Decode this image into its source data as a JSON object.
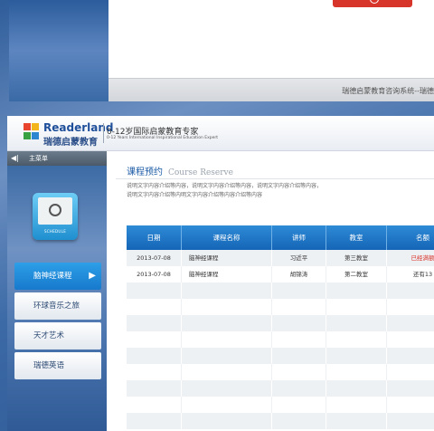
{
  "previous_window": {
    "footer_text": "瑞德启蒙教育咨询系统--瑞德",
    "partial_text": "……………………"
  },
  "header": {
    "brand_en": "Readerland",
    "brand_cn": "瑞德启蒙教育",
    "slogan": "0-12岁国际启蒙教育专家",
    "slogan_en": "0-12 Years International Inspirational Education Expert"
  },
  "sidebar": {
    "menu_title": "主菜单",
    "device_label": "SCHEDULE",
    "items": [
      {
        "label": "脑神经课程",
        "active": true
      },
      {
        "label": "环球音乐之旅",
        "active": false
      },
      {
        "label": "天才艺术",
        "active": false
      },
      {
        "label": "瑞德英语",
        "active": false
      }
    ]
  },
  "content": {
    "title": "课程预约",
    "title_en": "Course Reserve",
    "description_lines": [
      "说明文字内容介绍等内容，说明文字内容介绍等内容，说明文字内容介绍等内容，",
      "说明文字内容介绍等内明文字内容介绍等内容介绍等内容"
    ]
  },
  "table": {
    "columns": [
      "日期",
      "课程名称",
      "讲师",
      "教室",
      "名额"
    ],
    "rows": [
      [
        "2013-07-08",
        "脑神经课程",
        "习近平",
        "第三教室",
        "已经满额"
      ],
      [
        "2013-07-08",
        "脑神经课程",
        "胡锦涛",
        "第二教室",
        "还有13"
      ]
    ],
    "empty_rows": 9
  },
  "colors": {
    "accent": "#1b5aa6",
    "header_blue": "#1565b7",
    "full_status": "#d9342b"
  }
}
